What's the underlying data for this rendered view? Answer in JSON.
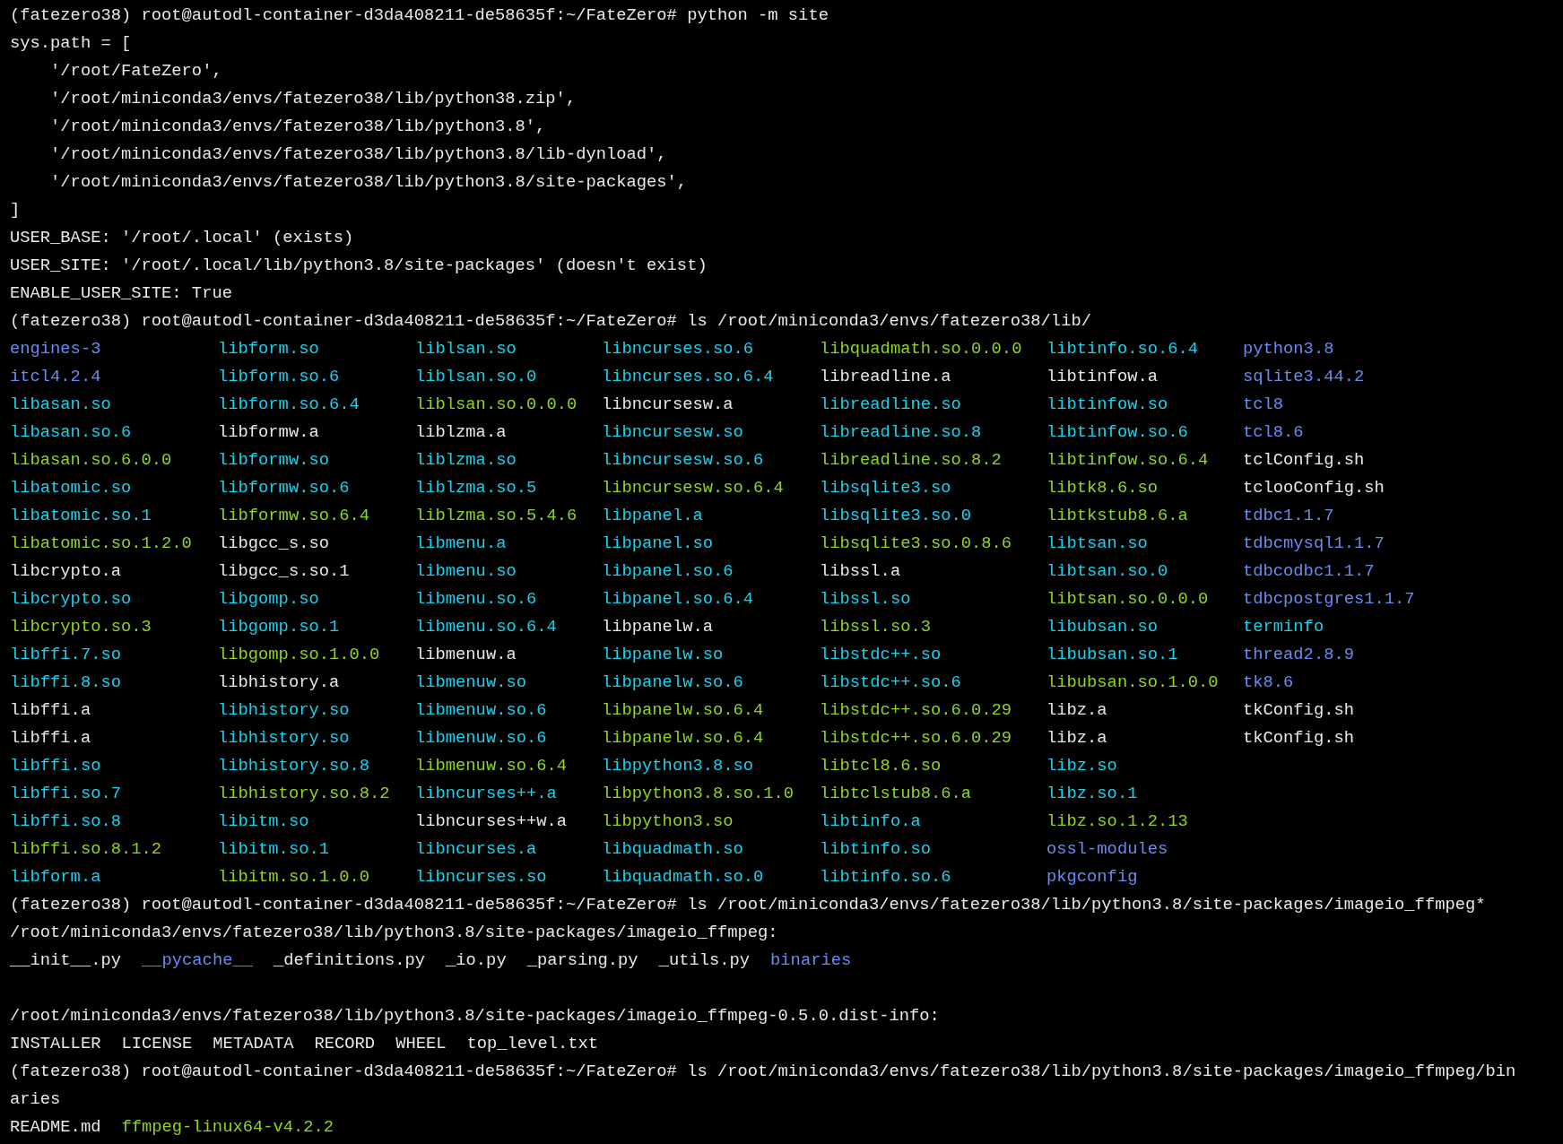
{
  "terminal": {
    "lines_before": [
      {
        "segments": [
          {
            "text": "(fatezero38) root@autodl-container-d3da408211-de58635f:~/FateZero# python -m site",
            "kind": "text"
          }
        ]
      },
      {
        "segments": [
          {
            "text": "sys.path = [",
            "kind": "text"
          }
        ]
      },
      {
        "segments": [
          {
            "text": "    '/root/FateZero',",
            "kind": "text"
          }
        ]
      },
      {
        "segments": [
          {
            "text": "    '/root/miniconda3/envs/fatezero38/lib/python38.zip',",
            "kind": "text"
          }
        ]
      },
      {
        "segments": [
          {
            "text": "    '/root/miniconda3/envs/fatezero38/lib/python3.8',",
            "kind": "text"
          }
        ]
      },
      {
        "segments": [
          {
            "text": "    '/root/miniconda3/envs/fatezero38/lib/python3.8/lib-dynload',",
            "kind": "text"
          }
        ]
      },
      {
        "segments": [
          {
            "text": "    '/root/miniconda3/envs/fatezero38/lib/python3.8/site-packages',",
            "kind": "text"
          }
        ]
      },
      {
        "segments": [
          {
            "text": "]",
            "kind": "text"
          }
        ]
      },
      {
        "segments": [
          {
            "text": "USER_BASE: '/root/.local' (exists)",
            "kind": "text"
          }
        ]
      },
      {
        "segments": [
          {
            "text": "USER_SITE: '/root/.local/lib/python3.8/site-packages' (doesn't exist)",
            "kind": "text"
          }
        ]
      },
      {
        "segments": [
          {
            "text": "ENABLE_USER_SITE: True",
            "kind": "text"
          }
        ]
      },
      {
        "segments": [
          {
            "text": "(fatezero38) root@autodl-container-d3da408211-de58635f:~/FateZero# ls /root/miniconda3/envs/fatezero38/lib/",
            "kind": "text"
          }
        ]
      }
    ],
    "listing": {
      "columns": [
        [
          {
            "text": "engines-3",
            "kind": "dir"
          },
          {
            "text": "itcl4.2.4",
            "kind": "dir"
          },
          {
            "text": "libasan.so",
            "kind": "link"
          },
          {
            "text": "libasan.so.6",
            "kind": "link"
          },
          {
            "text": "libasan.so.6.0.0",
            "kind": "exec"
          },
          {
            "text": "libatomic.so",
            "kind": "link"
          },
          {
            "text": "libatomic.so.1",
            "kind": "link"
          },
          {
            "text": "libatomic.so.1.2.0",
            "kind": "exec"
          },
          {
            "text": "libcrypto.a",
            "kind": "file"
          },
          {
            "text": "libcrypto.so",
            "kind": "link"
          },
          {
            "text": "libcrypto.so.3",
            "kind": "exec"
          },
          {
            "text": "libffi.7.so",
            "kind": "link"
          },
          {
            "text": "libffi.8.so",
            "kind": "link"
          },
          {
            "text": "libffi.a",
            "kind": "file"
          },
          {
            "text": "libffi.a",
            "kind": "file"
          },
          {
            "text": "libffi.so",
            "kind": "link"
          },
          {
            "text": "libffi.so.7",
            "kind": "link"
          },
          {
            "text": "libffi.so.8",
            "kind": "link"
          },
          {
            "text": "libffi.so.8.1.2",
            "kind": "exec"
          },
          {
            "text": "libform.a",
            "kind": "link"
          }
        ],
        [
          {
            "text": "libform.so",
            "kind": "link"
          },
          {
            "text": "libform.so.6",
            "kind": "link"
          },
          {
            "text": "libform.so.6.4",
            "kind": "link"
          },
          {
            "text": "libformw.a",
            "kind": "file"
          },
          {
            "text": "libformw.so",
            "kind": "link"
          },
          {
            "text": "libformw.so.6",
            "kind": "link"
          },
          {
            "text": "libformw.so.6.4",
            "kind": "exec"
          },
          {
            "text": "libgcc_s.so",
            "kind": "file"
          },
          {
            "text": "libgcc_s.so.1",
            "kind": "file"
          },
          {
            "text": "libgomp.so",
            "kind": "link"
          },
          {
            "text": "libgomp.so.1",
            "kind": "link"
          },
          {
            "text": "libgomp.so.1.0.0",
            "kind": "exec"
          },
          {
            "text": "libhistory.a",
            "kind": "file"
          },
          {
            "text": "libhistory.so",
            "kind": "link"
          },
          {
            "text": "libhistory.so",
            "kind": "link"
          },
          {
            "text": "libhistory.so.8",
            "kind": "link"
          },
          {
            "text": "libhistory.so.8.2",
            "kind": "exec"
          },
          {
            "text": "libitm.so",
            "kind": "link"
          },
          {
            "text": "libitm.so.1",
            "kind": "link"
          },
          {
            "text": "libitm.so.1.0.0",
            "kind": "exec"
          }
        ],
        [
          {
            "text": "liblsan.so",
            "kind": "link"
          },
          {
            "text": "liblsan.so.0",
            "kind": "link"
          },
          {
            "text": "liblsan.so.0.0.0",
            "kind": "exec"
          },
          {
            "text": "liblzma.a",
            "kind": "file"
          },
          {
            "text": "liblzma.so",
            "kind": "link"
          },
          {
            "text": "liblzma.so.5",
            "kind": "link"
          },
          {
            "text": "liblzma.so.5.4.6",
            "kind": "exec"
          },
          {
            "text": "libmenu.a",
            "kind": "link"
          },
          {
            "text": "libmenu.so",
            "kind": "link"
          },
          {
            "text": "libmenu.so.6",
            "kind": "link"
          },
          {
            "text": "libmenu.so.6.4",
            "kind": "link"
          },
          {
            "text": "libmenuw.a",
            "kind": "file"
          },
          {
            "text": "libmenuw.so",
            "kind": "link"
          },
          {
            "text": "libmenuw.so.6",
            "kind": "link"
          },
          {
            "text": "libmenuw.so.6",
            "kind": "link"
          },
          {
            "text": "libmenuw.so.6.4",
            "kind": "exec"
          },
          {
            "text": "libncurses++.a",
            "kind": "link"
          },
          {
            "text": "libncurses++w.a",
            "kind": "file"
          },
          {
            "text": "libncurses.a",
            "kind": "link"
          },
          {
            "text": "libncurses.so",
            "kind": "link"
          }
        ],
        [
          {
            "text": "libncurses.so.6",
            "kind": "link"
          },
          {
            "text": "libncurses.so.6.4",
            "kind": "link"
          },
          {
            "text": "libncursesw.a",
            "kind": "file"
          },
          {
            "text": "libncursesw.so",
            "kind": "link"
          },
          {
            "text": "libncursesw.so.6",
            "kind": "link"
          },
          {
            "text": "libncursesw.so.6.4",
            "kind": "exec"
          },
          {
            "text": "libpanel.a",
            "kind": "link"
          },
          {
            "text": "libpanel.so",
            "kind": "link"
          },
          {
            "text": "libpanel.so.6",
            "kind": "link"
          },
          {
            "text": "libpanel.so.6.4",
            "kind": "link"
          },
          {
            "text": "libpanelw.a",
            "kind": "file"
          },
          {
            "text": "libpanelw.so",
            "kind": "link"
          },
          {
            "text": "libpanelw.so.6",
            "kind": "link"
          },
          {
            "text": "libpanelw.so.6.4",
            "kind": "exec"
          },
          {
            "text": "libpanelw.so.6.4",
            "kind": "exec"
          },
          {
            "text": "libpython3.8.so",
            "kind": "link"
          },
          {
            "text": "libpython3.8.so.1.0",
            "kind": "exec"
          },
          {
            "text": "libpython3.so",
            "kind": "exec"
          },
          {
            "text": "libquadmath.so",
            "kind": "link"
          },
          {
            "text": "libquadmath.so.0",
            "kind": "link"
          }
        ],
        [
          {
            "text": "libquadmath.so.0.0.0",
            "kind": "exec"
          },
          {
            "text": "libreadline.a",
            "kind": "file"
          },
          {
            "text": "libreadline.so",
            "kind": "link"
          },
          {
            "text": "libreadline.so.8",
            "kind": "link"
          },
          {
            "text": "libreadline.so.8.2",
            "kind": "exec"
          },
          {
            "text": "libsqlite3.so",
            "kind": "link"
          },
          {
            "text": "libsqlite3.so.0",
            "kind": "link"
          },
          {
            "text": "libsqlite3.so.0.8.6",
            "kind": "exec"
          },
          {
            "text": "libssl.a",
            "kind": "file"
          },
          {
            "text": "libssl.so",
            "kind": "link"
          },
          {
            "text": "libssl.so.3",
            "kind": "exec"
          },
          {
            "text": "libstdc++.so",
            "kind": "link"
          },
          {
            "text": "libstdc++.so.6",
            "kind": "link"
          },
          {
            "text": "libstdc++.so.6.0.29",
            "kind": "exec"
          },
          {
            "text": "libstdc++.so.6.0.29",
            "kind": "exec"
          },
          {
            "text": "libtcl8.6.so",
            "kind": "exec"
          },
          {
            "text": "libtclstub8.6.a",
            "kind": "exec"
          },
          {
            "text": "libtinfo.a",
            "kind": "link"
          },
          {
            "text": "libtinfo.so",
            "kind": "link"
          },
          {
            "text": "libtinfo.so.6",
            "kind": "link"
          }
        ],
        [
          {
            "text": "libtinfo.so.6.4",
            "kind": "link"
          },
          {
            "text": "libtinfow.a",
            "kind": "file"
          },
          {
            "text": "libtinfow.so",
            "kind": "link"
          },
          {
            "text": "libtinfow.so.6",
            "kind": "link"
          },
          {
            "text": "libtinfow.so.6.4",
            "kind": "exec"
          },
          {
            "text": "libtk8.6.so",
            "kind": "exec"
          },
          {
            "text": "libtkstub8.6.a",
            "kind": "exec"
          },
          {
            "text": "libtsan.so",
            "kind": "link"
          },
          {
            "text": "libtsan.so.0",
            "kind": "link"
          },
          {
            "text": "libtsan.so.0.0.0",
            "kind": "exec"
          },
          {
            "text": "libubsan.so",
            "kind": "link"
          },
          {
            "text": "libubsan.so.1",
            "kind": "link"
          },
          {
            "text": "libubsan.so.1.0.0",
            "kind": "exec"
          },
          {
            "text": "libz.a",
            "kind": "file"
          },
          {
            "text": "libz.a",
            "kind": "file"
          },
          {
            "text": "libz.so",
            "kind": "link"
          },
          {
            "text": "libz.so.1",
            "kind": "link"
          },
          {
            "text": "libz.so.1.2.13",
            "kind": "exec"
          },
          {
            "text": "ossl-modules",
            "kind": "dir"
          },
          {
            "text": "pkgconfig",
            "kind": "dir"
          }
        ],
        [
          {
            "text": "python3.8",
            "kind": "dir"
          },
          {
            "text": "sqlite3.44.2",
            "kind": "dir"
          },
          {
            "text": "tcl8",
            "kind": "dir"
          },
          {
            "text": "tcl8.6",
            "kind": "dir"
          },
          {
            "text": "tclConfig.sh",
            "kind": "file"
          },
          {
            "text": "tclooConfig.sh",
            "kind": "file"
          },
          {
            "text": "tdbc1.1.7",
            "kind": "dir"
          },
          {
            "text": "tdbcmysql1.1.7",
            "kind": "dir"
          },
          {
            "text": "tdbcodbc1.1.7",
            "kind": "dir"
          },
          {
            "text": "tdbcpostgres1.1.7",
            "kind": "dir"
          },
          {
            "text": "terminfo",
            "kind": "link"
          },
          {
            "text": "thread2.8.9",
            "kind": "dir"
          },
          {
            "text": "tk8.6",
            "kind": "dir"
          },
          {
            "text": "tkConfig.sh",
            "kind": "file"
          },
          {
            "text": "tkConfig.sh",
            "kind": "file"
          }
        ]
      ]
    },
    "lines_after": [
      {
        "segments": [
          {
            "text": "(fatezero38) root@autodl-container-d3da408211-de58635f:~/FateZero# ls /root/miniconda3/envs/fatezero38/lib/python3.8/site-packages/imageio_ffmpeg*",
            "kind": "text"
          }
        ]
      },
      {
        "groups": [
          {
            "segments": [
              {
                "text": "/root/miniconda3/envs/fatezero38/lib/python3.8/site-packages/imageio_ffmpeg:",
                "kind": "text"
              }
            ]
          },
          {
            "segments": [
              {
                "text": "__init__.py",
                "kind": "file"
              },
              {
                "text": "__pycache__",
                "kind": "dir"
              },
              {
                "text": "_definitions.py",
                "kind": "file"
              },
              {
                "text": "_io.py",
                "kind": "file"
              },
              {
                "text": "_parsing.py",
                "kind": "file"
              },
              {
                "text": "_utils.py",
                "kind": "file"
              },
              {
                "text": "binaries",
                "kind": "dir"
              }
            ]
          }
        ]
      },
      {
        "groups": [
          {
            "segments": [
              {
                "text": "/root/miniconda3/envs/fatezero38/lib/python3.8/site-packages/imageio_ffmpeg-0.5.0.dist-info:",
                "kind": "text"
              }
            ]
          },
          {
            "segments": [
              {
                "text": "INSTALLER",
                "kind": "file"
              },
              {
                "text": "LICENSE",
                "kind": "file"
              },
              {
                "text": "METADATA",
                "kind": "file"
              },
              {
                "text": "RECORD",
                "kind": "file"
              },
              {
                "text": "WHEEL",
                "kind": "file"
              },
              {
                "text": "top_level.txt",
                "kind": "file"
              }
            ]
          }
        ]
      },
      {
        "segments": [
          {
            "text": "(fatezero38) root@autodl-container-d3da408211-de58635f:~/FateZero# ls /root/miniconda3/envs/fatezero38/lib/python3.8/site-packages/imageio_ffmpeg/bin",
            "kind": "text"
          }
        ]
      },
      {
        "segments": [
          {
            "text": "aries",
            "kind": "text"
          }
        ]
      },
      {
        "segments": [
          {
            "text": "README.md",
            "kind": "file"
          },
          {
            "text": "ffmpeg-linux64-v4.2.2",
            "kind": "exec"
          }
        ]
      }
    ]
  }
}
